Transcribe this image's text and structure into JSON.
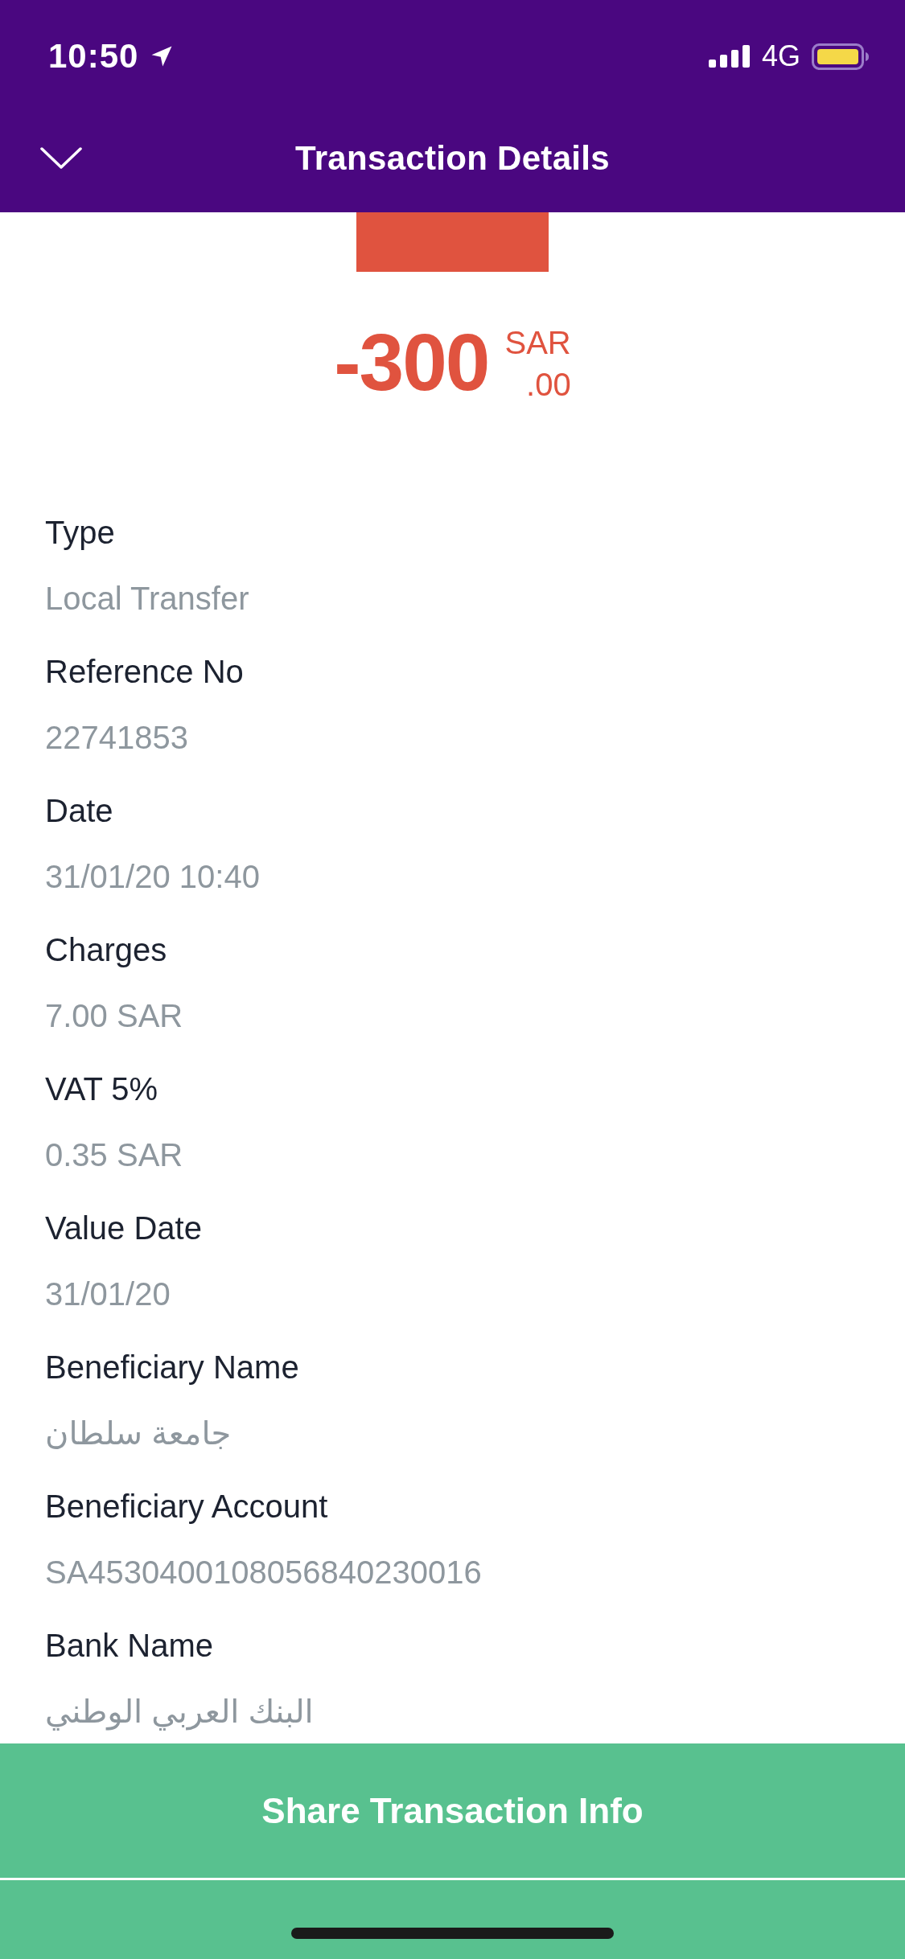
{
  "status_bar": {
    "time": "10:50",
    "network": "4G"
  },
  "header": {
    "title": "Transaction Details"
  },
  "amount": {
    "kind": "debit",
    "value": "-300",
    "currency": "SAR",
    "decimals": ".00"
  },
  "details": [
    {
      "label": "Type",
      "value": "Local Transfer"
    },
    {
      "label": "Reference No",
      "value": "22741853"
    },
    {
      "label": "Date",
      "value": "31/01/20 10:40"
    },
    {
      "label": "Charges",
      "value": "7.00 SAR"
    },
    {
      "label": "VAT 5%",
      "value": "0.35 SAR"
    },
    {
      "label": "Value Date",
      "value": "31/01/20"
    },
    {
      "label": "Beneficiary Name",
      "value": "جامعة سلطان"
    },
    {
      "label": "Beneficiary Account",
      "value": "SA4530400108056840230016"
    },
    {
      "label": "Bank Name",
      "value": "البنك العربي الوطني"
    }
  ],
  "share_button": {
    "label": "Share Transaction Info"
  }
}
